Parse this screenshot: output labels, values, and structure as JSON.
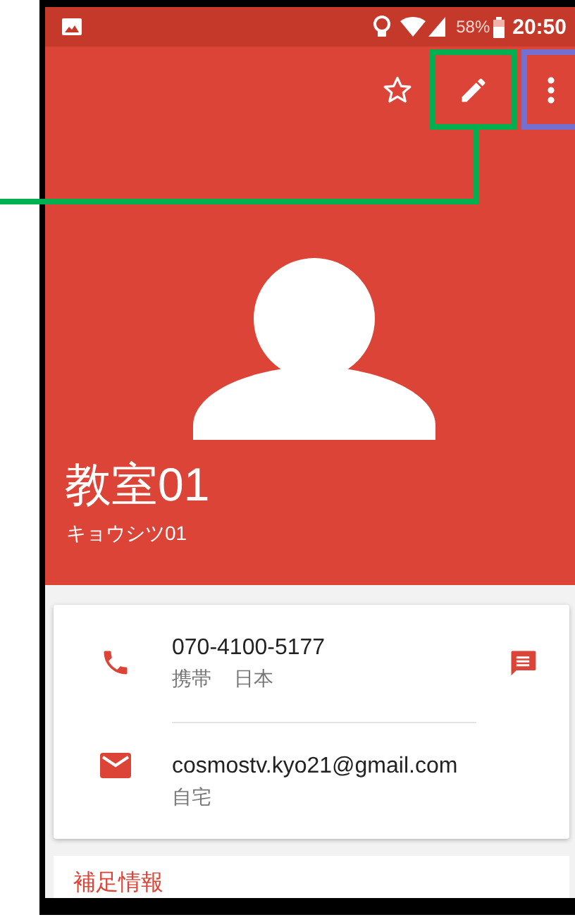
{
  "status_bar": {
    "battery": "58%",
    "time": "20:50"
  },
  "actions": [
    {
      "kind": "star"
    },
    {
      "kind": "edit",
      "color": "#00b050",
      "callout": true
    },
    {
      "kind": "more",
      "color": "#7470cf"
    }
  ],
  "contact": {
    "name": "教室01",
    "reading": "キョウシツ01"
  },
  "details": [
    {
      "kind": "phone",
      "value": "070-4100-5177",
      "labels": [
        "携帯",
        "日本"
      ],
      "message_button": true
    },
    {
      "kind": "email",
      "value": "cosmostv.kyo21@gmail.com",
      "labels": [
        "自宅"
      ]
    }
  ],
  "sections": [
    {
      "title": "補足情報"
    }
  ]
}
